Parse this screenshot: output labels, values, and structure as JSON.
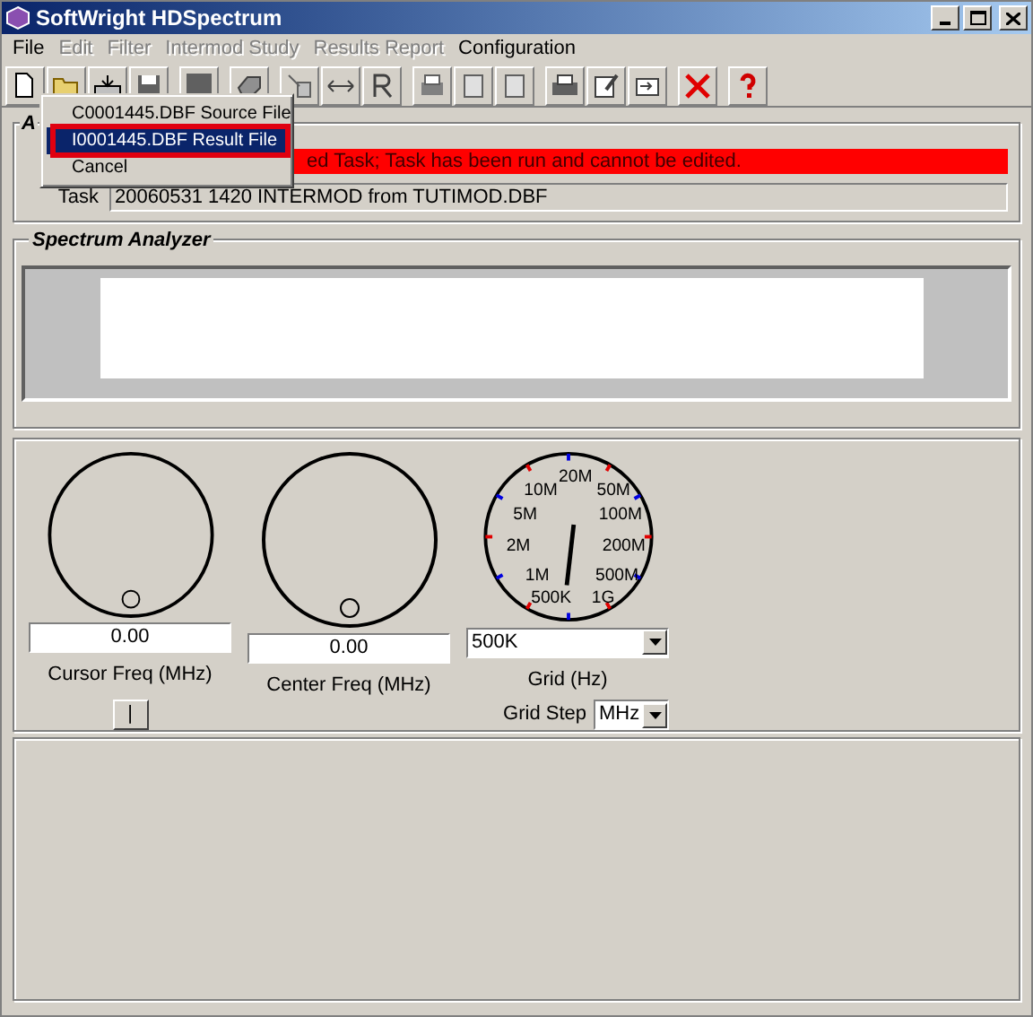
{
  "window": {
    "title": "SoftWright HDSpectrum"
  },
  "menu": [
    {
      "label": "File",
      "disabled": false
    },
    {
      "label": "Edit",
      "disabled": true
    },
    {
      "label": "Filter",
      "disabled": true
    },
    {
      "label": "Intermod Study",
      "disabled": true
    },
    {
      "label": "Results Report",
      "disabled": true
    },
    {
      "label": "Configuration",
      "disabled": false
    }
  ],
  "popup_menu": [
    {
      "label": "C0001445.DBF Source File",
      "selected": false
    },
    {
      "label": "I0001445.DBF Result File",
      "selected": true
    },
    {
      "label": "Cancel",
      "selected": false
    }
  ],
  "task_group": {
    "title": "A",
    "banner": "ed Task; Task has been run and cannot be edited.",
    "task_label": "Task",
    "task_value": "20060531 1420 INTERMOD from TUTIMOD.DBF"
  },
  "spectrum_group": {
    "title": "Spectrum Analyzer"
  },
  "dials": [
    {
      "kind": "knob",
      "value": "0.00",
      "label": "Cursor Freq (MHz)"
    },
    {
      "kind": "knob",
      "value": "0.00",
      "label": "Center Freq (MHz)"
    },
    {
      "kind": "scale",
      "value": "500K",
      "label": "Grid (Hz)",
      "scale_labels": [
        "20M",
        "10M",
        "50M",
        "5M",
        "100M",
        "2M",
        "200M",
        "1M",
        "500M",
        "500K",
        "1G"
      ]
    }
  ],
  "cursor_button": "|",
  "grid_step": {
    "label": "Grid Step",
    "value": "MHz"
  }
}
